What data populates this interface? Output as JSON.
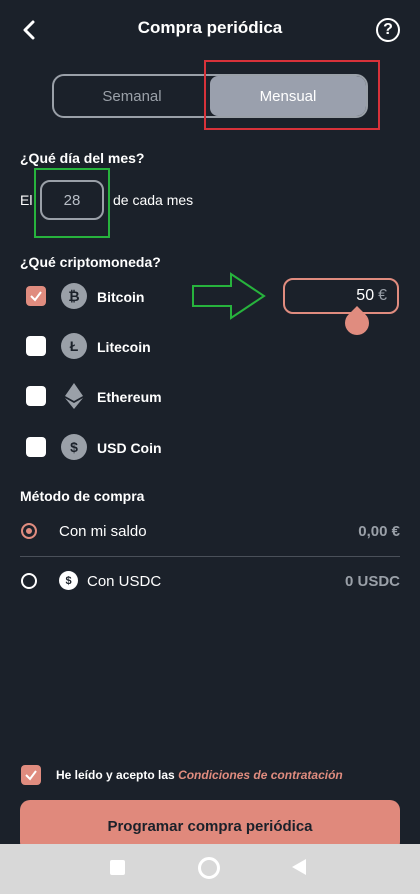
{
  "header": {
    "title": "Compra periódica",
    "back_icon": "back-chevron-icon",
    "help_label": "?"
  },
  "frequency": {
    "options": [
      "Semanal",
      "Mensual"
    ],
    "selected": "Mensual"
  },
  "day_section": {
    "heading": "¿Qué día del mes?",
    "prefix": "El",
    "day_value": "28",
    "suffix": "de cada mes"
  },
  "crypto_section": {
    "heading": "¿Qué criptomoneda?",
    "items": [
      {
        "name": "Bitcoin",
        "checked": true,
        "icon": "bitcoin-icon",
        "glyph": "₿"
      },
      {
        "name": "Litecoin",
        "checked": false,
        "icon": "litecoin-icon",
        "glyph": "Ł"
      },
      {
        "name": "Ethereum",
        "checked": false,
        "icon": "ethereum-icon",
        "glyph": "◆"
      },
      {
        "name": "USD Coin",
        "checked": false,
        "icon": "usd-coin-icon",
        "glyph": "$"
      }
    ],
    "amount_value": "50",
    "amount_currency": "€"
  },
  "payment": {
    "heading": "Método de compra",
    "options": [
      {
        "label": "Con mi saldo",
        "value": "0,00 €",
        "selected": true
      },
      {
        "label": "Con USDC",
        "value": "0 USDC",
        "selected": false
      }
    ]
  },
  "terms": {
    "text": "He leído y acepto las",
    "link": "Condiciones de contratación",
    "checked": true
  },
  "cta_label": "Programar compra periódica",
  "colors": {
    "background": "#1b212a",
    "accent": "#e08c7f",
    "highlight_red": "#d8323a",
    "highlight_green": "#27b33d"
  }
}
